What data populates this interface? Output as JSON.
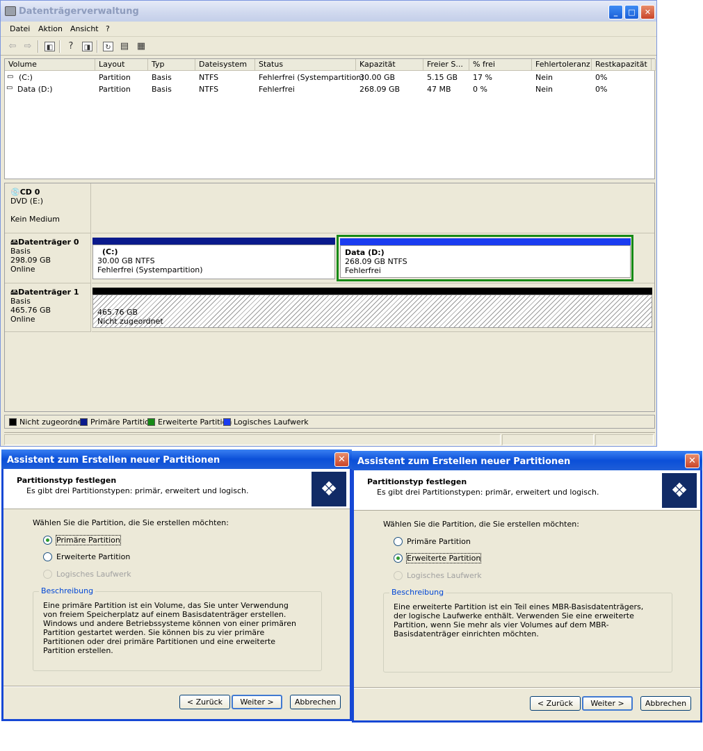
{
  "main_window": {
    "title": "Datenträgerverwaltung",
    "menu": [
      "Datei",
      "Aktion",
      "Ansicht",
      "?"
    ],
    "toolbar_icons": [
      "back-arrow-icon",
      "forward-arrow-icon",
      "console-tree-icon",
      "help-icon",
      "properties-icon",
      "refresh-icon",
      "export-icon",
      "settings-icon"
    ],
    "list": {
      "columns": [
        "Volume",
        "Layout",
        "Typ",
        "Dateisystem",
        "Status",
        "Kapazität",
        "Freier S...",
        "% frei",
        "Fehlertoleranz",
        "Restkapazität"
      ],
      "rows": [
        [
          "(C:)",
          "Partition",
          "Basis",
          "NTFS",
          "Fehlerfrei (Systempartition)",
          "30.00 GB",
          "5.15 GB",
          "17 %",
          "Nein",
          "0%"
        ],
        [
          "Data (D:)",
          "Partition",
          "Basis",
          "NTFS",
          "Fehlerfrei",
          "268.09 GB",
          "47 MB",
          "0 %",
          "Nein",
          "0%"
        ]
      ]
    },
    "disks": {
      "cd0": {
        "name": "CD 0",
        "line1": "DVD (E:)",
        "line2": "Kein Medium"
      },
      "disk0": {
        "name": "Datenträger 0",
        "type": "Basis",
        "size": "298.09 GB",
        "state": "Online",
        "p1": {
          "label": "(C:)",
          "size": "30.00 GB NTFS",
          "status": "Fehlerfrei (Systempartition)"
        },
        "p2": {
          "label": "Data  (D:)",
          "size": "268.09 GB NTFS",
          "status": "Fehlerfrei"
        }
      },
      "disk1": {
        "name": "Datenträger 1",
        "type": "Basis",
        "size": "465.76 GB",
        "state": "Online",
        "p1": {
          "size": "465.76 GB",
          "status": "Nicht zugeordnet"
        }
      }
    },
    "legend": [
      {
        "label": "Nicht zugeordnet",
        "color": "#000000"
      },
      {
        "label": "Primäre Partition",
        "color": "#0a1a8c"
      },
      {
        "label": "Erweiterte Partition",
        "color": "#168a16"
      },
      {
        "label": "Logisches Laufwerk",
        "color": "#1a3cf0"
      }
    ]
  },
  "dialog_left": {
    "title": "Assistent zum Erstellen neuer Partitionen",
    "heading": "Partitionstyp festlegen",
    "subheading": "Es gibt drei Partitionstypen: primär, erweitert und logisch.",
    "question": "Wählen Sie die Partition, die Sie erstellen möchten:",
    "options": [
      "Primäre Partition",
      "Erweiterte Partition",
      "Logisches Laufwerk"
    ],
    "selected": "Primäre Partition",
    "group_label": "Beschreibung",
    "description": "Eine primäre Partition ist ein Volume, das Sie unter Verwendung von freiem Speicherplatz auf einem Basisdatenträger erstellen. Windows und andere Betriebssysteme können von einer primären Partition gestartet werden. Sie können bis zu vier primäre Partitionen oder drei primäre Partitionen und eine erweiterte Partition erstellen.",
    "buttons": [
      "< Zurück",
      "Weiter >",
      "Abbrechen"
    ]
  },
  "dialog_right": {
    "title": "Assistent zum Erstellen neuer Partitionen",
    "heading": "Partitionstyp festlegen",
    "subheading": "Es gibt drei Partitionstypen: primär, erweitert und logisch.",
    "question": "Wählen Sie die Partition, die Sie erstellen möchten:",
    "options": [
      "Primäre Partition",
      "Erweiterte Partition",
      "Logisches Laufwerk"
    ],
    "selected": "Erweiterte Partition",
    "group_label": "Beschreibung",
    "description": "Eine erweiterte Partition ist ein Teil eines MBR-Basisdatenträgers, der logische Laufwerke enthält. Verwenden Sie eine erweiterte Partition, wenn Sie mehr als vier Volumes auf dem MBR-Basisdatenträger einrichten möchten.",
    "buttons": [
      "< Zurück",
      "Weiter >",
      "Abbrechen"
    ]
  }
}
